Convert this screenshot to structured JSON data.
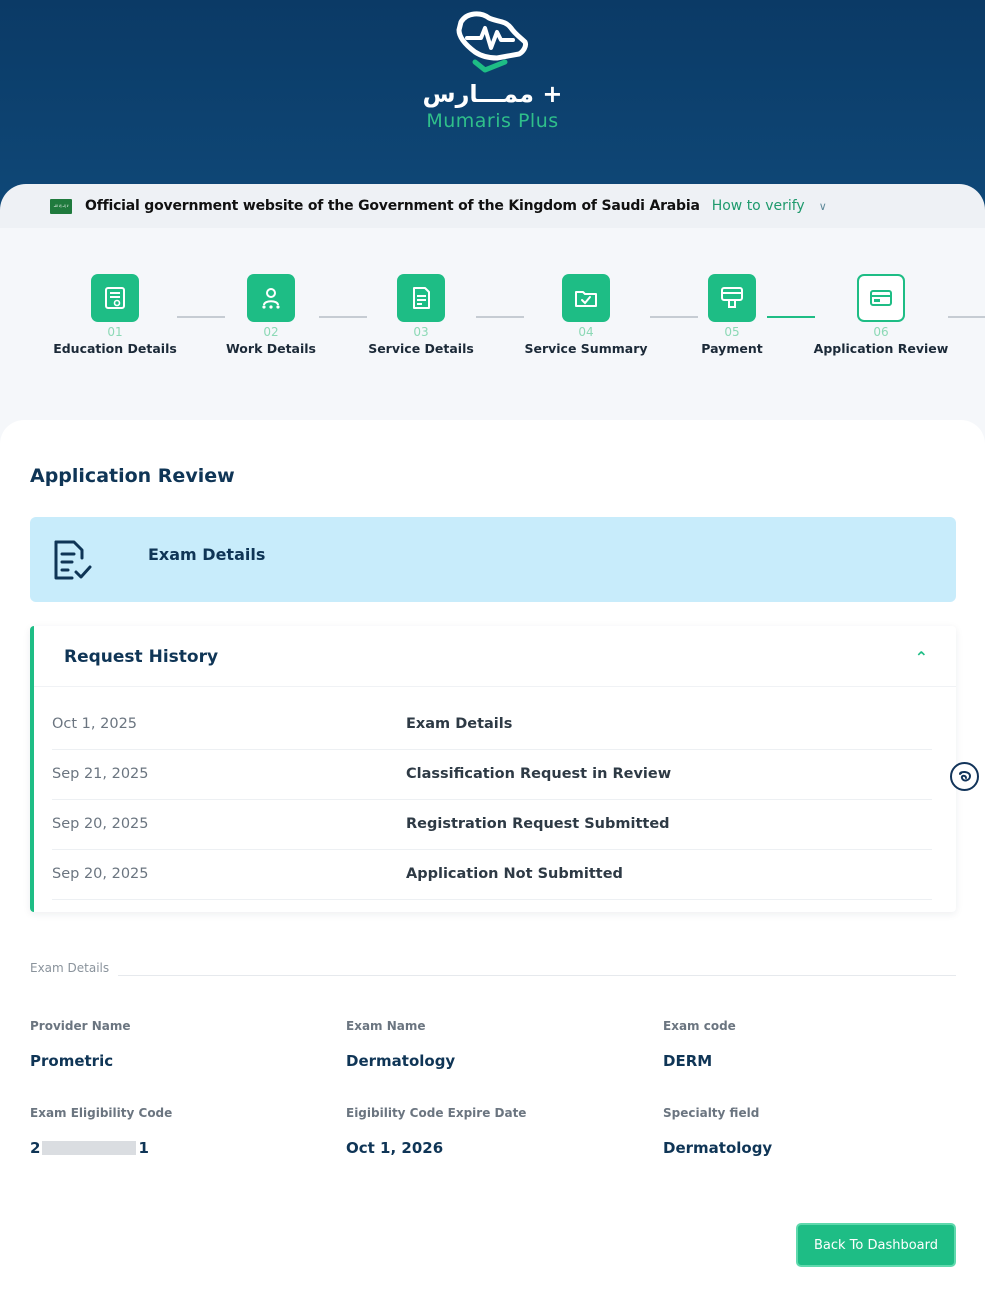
{
  "brand": {
    "name_ar": "ممـــارس +",
    "name_en": "Mumaris Plus",
    "accent": "#1ebd85",
    "header_bg": "#0b3a66"
  },
  "gov_bar": {
    "flag_text": "لا إله إلا الله",
    "text": "Official government website of the Government of the Kingdom of Saudi Arabia",
    "verify_label": "How to verify"
  },
  "steps": [
    {
      "num": "01",
      "label": "Education Details",
      "icon": "certificate-icon",
      "state": "done"
    },
    {
      "num": "02",
      "label": "Work Details",
      "icon": "team-icon",
      "state": "done"
    },
    {
      "num": "03",
      "label": "Service Details",
      "icon": "document-icon",
      "state": "done"
    },
    {
      "num": "04",
      "label": "Service Summary",
      "icon": "folder-check-icon",
      "state": "done"
    },
    {
      "num": "05",
      "label": "Payment",
      "icon": "payment-icon",
      "state": "done"
    },
    {
      "num": "06",
      "label": "Application Review",
      "icon": "card-icon",
      "state": "current"
    }
  ],
  "page_title": "Application Review",
  "exam_banner": {
    "label": "Exam Details"
  },
  "request_history": {
    "title": "Request History",
    "rows": [
      {
        "date": "Oct 1, 2025",
        "description": "Exam Details"
      },
      {
        "date": "Sep 21, 2025",
        "description": "Classification Request in Review"
      },
      {
        "date": "Sep 20, 2025",
        "description": "Registration Request Submitted"
      },
      {
        "date": "Sep 20, 2025",
        "description": "Application Not Submitted"
      }
    ]
  },
  "exam_details": {
    "section_label": "Exam Details",
    "provider_name": {
      "label": "Provider Name",
      "value": "Prometric"
    },
    "exam_name": {
      "label": "Exam Name",
      "value": "Dermatology"
    },
    "exam_code": {
      "label": "Exam code",
      "value": "DERM"
    },
    "eligibility_code": {
      "label": "Exam Eligibility Code",
      "prefix": "2",
      "suffix": "1"
    },
    "expire_date": {
      "label": "Eigibility Code Expire Date",
      "value": "Oct 1, 2026"
    },
    "specialty": {
      "label": "Specialty field",
      "value": "Dermatology"
    }
  },
  "actions": {
    "back_label": "Back To Dashboard"
  }
}
